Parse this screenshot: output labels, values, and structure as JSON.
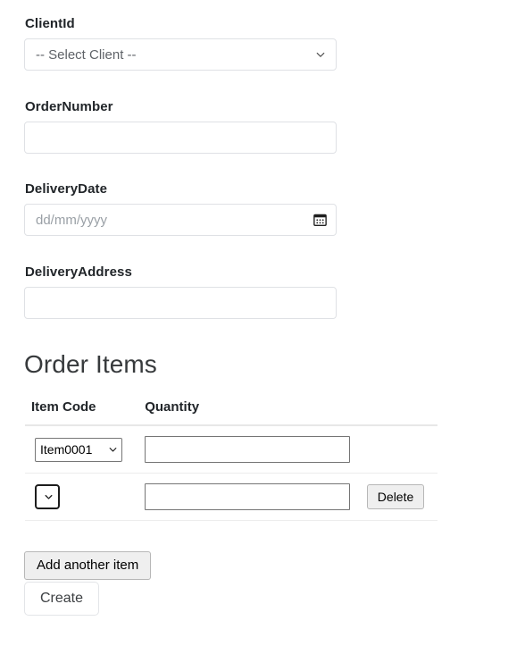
{
  "form": {
    "fields": [
      {
        "name": "client-id",
        "label": "ClientId",
        "control": "select",
        "selected": "-- Select Client --",
        "options": [
          "-- Select Client --"
        ],
        "value": "",
        "placeholder": ""
      },
      {
        "name": "order-number",
        "label": "OrderNumber",
        "control": "text",
        "value": "",
        "placeholder": ""
      },
      {
        "name": "delivery-date",
        "label": "DeliveryDate",
        "control": "date",
        "value": "",
        "placeholder": "dd/mm/yyyy"
      },
      {
        "name": "delivery-address",
        "label": "DeliveryAddress",
        "control": "text",
        "value": "",
        "placeholder": ""
      }
    ]
  },
  "order_items": {
    "heading": "Order Items",
    "columns": [
      "Item Code",
      "Quantity",
      ""
    ],
    "rows": [
      {
        "item_code": "Item0001",
        "item_code_options": [
          "Item0001"
        ],
        "quantity": "",
        "action_label": ""
      },
      {
        "item_code": "",
        "item_code_options": [
          ""
        ],
        "quantity": "",
        "action_label": "Delete"
      }
    ],
    "add_label": "Add another item"
  },
  "actions": {
    "create_label": "Create"
  },
  "icons": {
    "chevron_down": "chevron-down-icon",
    "calendar": "calendar-icon"
  },
  "colors": {
    "text": "#212529",
    "heading": "#373a3c",
    "placeholder": "#9aa0a6",
    "field_border": "#dfe1e5",
    "table_rule": "#e7e7e7",
    "button_face": "#efefef",
    "background": "#ffffff"
  }
}
